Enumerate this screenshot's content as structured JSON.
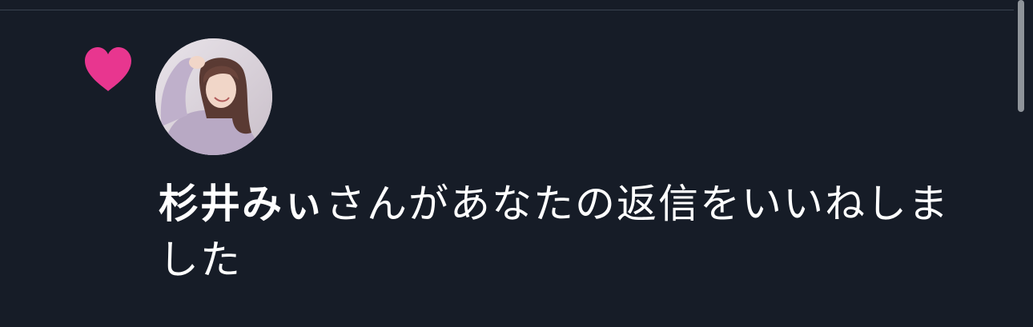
{
  "notification": {
    "icon": "heart-icon",
    "accent_color": "#e8368f",
    "avatar": "user-avatar-photo",
    "user_name": "杉井みぃ",
    "message": "さんがあなたの返信をいいねしました"
  },
  "colors": {
    "background": "#161c27",
    "text": "#ffffff",
    "divider": "#3a4350"
  }
}
